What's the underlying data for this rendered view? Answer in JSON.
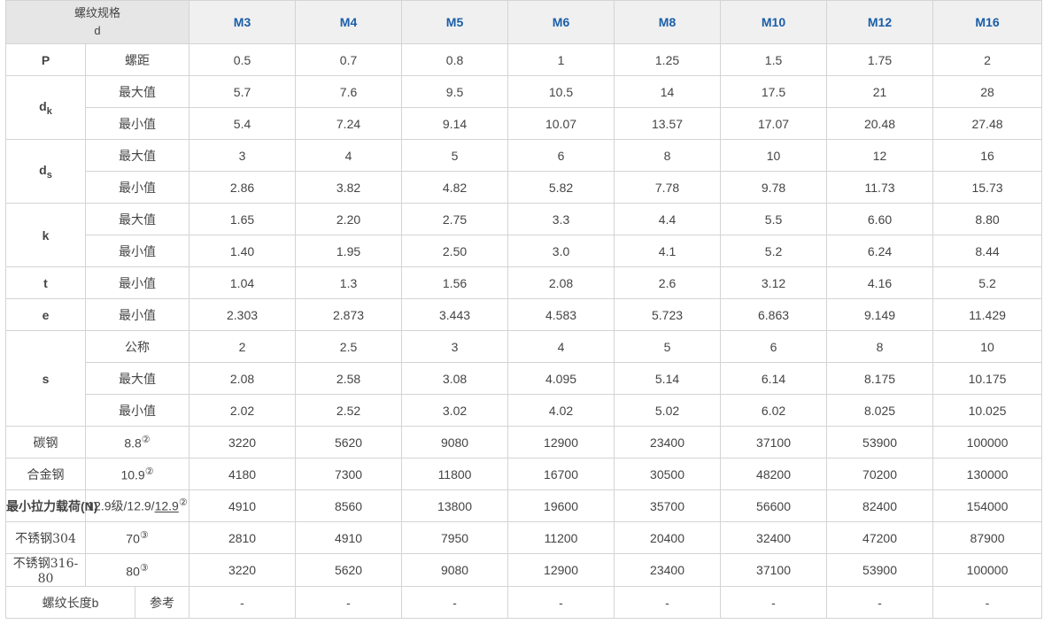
{
  "header": {
    "corner_line1": "螺纹规格",
    "corner_line2": "d",
    "sizes": [
      "M3",
      "M4",
      "M5",
      "M6",
      "M8",
      "M10",
      "M12",
      "M16"
    ]
  },
  "rows": {
    "p": {
      "symbol": "P",
      "label": "螺距",
      "values": [
        "0.5",
        "0.7",
        "0.8",
        "1",
        "1.25",
        "1.5",
        "1.75",
        "2"
      ]
    },
    "dk_max": {
      "symbol": "d",
      "symbol_sub": "k",
      "label": "最大值",
      "values": [
        "5.7",
        "7.6",
        "9.5",
        "10.5",
        "14",
        "17.5",
        "21",
        "28"
      ]
    },
    "dk_min": {
      "label": "最小值",
      "values": [
        "5.4",
        "7.24",
        "9.14",
        "10.07",
        "13.57",
        "17.07",
        "20.48",
        "27.48"
      ]
    },
    "ds_max": {
      "symbol": "d",
      "symbol_sub": "s",
      "label": "最大值",
      "values": [
        "3",
        "4",
        "5",
        "6",
        "8",
        "10",
        "12",
        "16"
      ]
    },
    "ds_min": {
      "label": "最小值",
      "values": [
        "2.86",
        "3.82",
        "4.82",
        "5.82",
        "7.78",
        "9.78",
        "11.73",
        "15.73"
      ]
    },
    "k_max": {
      "symbol": "k",
      "label": "最大值",
      "values": [
        "1.65",
        "2.20",
        "2.75",
        "3.3",
        "4.4",
        "5.5",
        "6.60",
        "8.80"
      ]
    },
    "k_min": {
      "label": "最小值",
      "values": [
        "1.40",
        "1.95",
        "2.50",
        "3.0",
        "4.1",
        "5.2",
        "6.24",
        "8.44"
      ]
    },
    "t_min": {
      "symbol": "t",
      "label": "最小值",
      "values": [
        "1.04",
        "1.3",
        "1.56",
        "2.08",
        "2.6",
        "3.12",
        "4.16",
        "5.2"
      ]
    },
    "e_min": {
      "symbol": "e",
      "label": "最小值",
      "values": [
        "2.303",
        "2.873",
        "3.443",
        "4.583",
        "5.723",
        "6.863",
        "9.149",
        "11.429"
      ]
    },
    "s_nom": {
      "symbol": "s",
      "label": "公称",
      "values": [
        "2",
        "2.5",
        "3",
        "4",
        "5",
        "6",
        "8",
        "10"
      ]
    },
    "s_max": {
      "label": "最大值",
      "values": [
        "2.08",
        "2.58",
        "3.08",
        "4.095",
        "5.14",
        "6.14",
        "8.175",
        "10.175"
      ]
    },
    "s_min": {
      "label": "最小值",
      "values": [
        "2.02",
        "2.52",
        "3.02",
        "4.02",
        "5.02",
        "6.02",
        "8.025",
        "10.025"
      ]
    },
    "carbon": {
      "material": "碳钢",
      "grade": "8.8",
      "mark": "②",
      "values": [
        "3220",
        "5620",
        "9080",
        "12900",
        "23400",
        "37100",
        "53900",
        "100000"
      ]
    },
    "alloy": {
      "material": "合金钢",
      "grade": "10.9",
      "mark": "②",
      "values": [
        "4180",
        "7300",
        "11800",
        "16700",
        "30500",
        "48200",
        "70200",
        "130000"
      ]
    },
    "load129": {
      "material": "最小拉力载荷(N)",
      "grade_a": "12.9级/12.9/",
      "grade_b": "12.9",
      "mark": "②",
      "values": [
        "4910",
        "8560",
        "13800",
        "19600",
        "35700",
        "56600",
        "82400",
        "154000"
      ]
    },
    "ss304": {
      "material": "不锈钢304",
      "grade": "70",
      "mark": "③",
      "values": [
        "2810",
        "4910",
        "7950",
        "11200",
        "20400",
        "32400",
        "47200",
        "87900"
      ]
    },
    "ss316": {
      "material": "不锈钢316-80",
      "grade": "80",
      "mark": "③",
      "values": [
        "3220",
        "5620",
        "9080",
        "12900",
        "23400",
        "37100",
        "53900",
        "100000"
      ]
    },
    "thread_len": {
      "label": "螺纹长度b",
      "ref": "参考",
      "values": [
        "-",
        "-",
        "-",
        "-",
        "-",
        "-",
        "-",
        "-"
      ]
    }
  }
}
